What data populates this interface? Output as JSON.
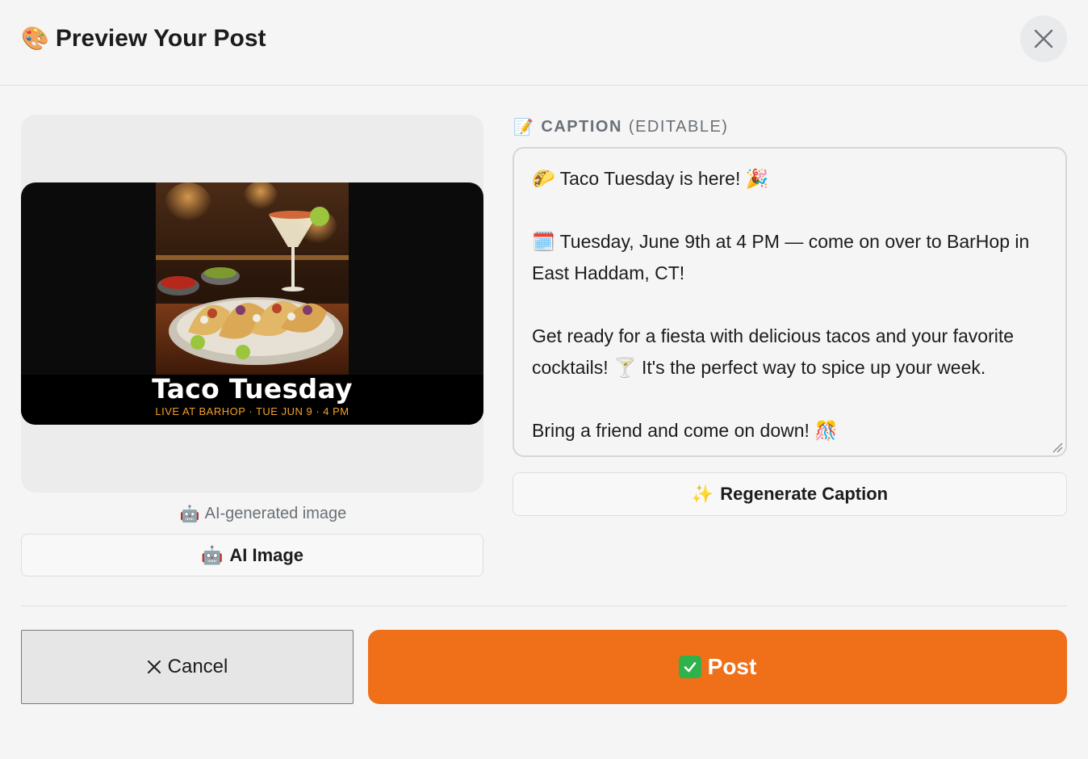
{
  "header": {
    "title_emoji": "🎨",
    "title": "Preview Your Post",
    "close_icon": "close-icon"
  },
  "preview": {
    "poster_title": "Taco Tuesday",
    "poster_subtitle": "LIVE AT BARHOP · TUE JUN 9 · 4 PM",
    "ai_note_emoji": "🤖",
    "ai_note": "AI-generated image",
    "ai_image_button_emoji": "🤖",
    "ai_image_button": "AI Image"
  },
  "caption": {
    "label_emoji": "📝",
    "label": "CAPTION",
    "label_suffix": "(EDITABLE)",
    "text": "🌮 Taco Tuesday is here! 🎉\n\n🗓️ Tuesday, June 9th at 4 PM — come on over to BarHop in East Haddam, CT!\n\nGet ready for a fiesta with delicious tacos and your favorite cocktails! 🍸 It's the perfect way to spice up your week.\n\nBring a friend and come on down! 🎊",
    "regenerate_emoji": "✨",
    "regenerate_button": "Regenerate Caption"
  },
  "footer": {
    "cancel_button": "Cancel",
    "post_button": "Post"
  },
  "colors": {
    "post_button": "#f07019",
    "poster_subtitle": "#f2a12a",
    "check": "#2fb14b"
  }
}
